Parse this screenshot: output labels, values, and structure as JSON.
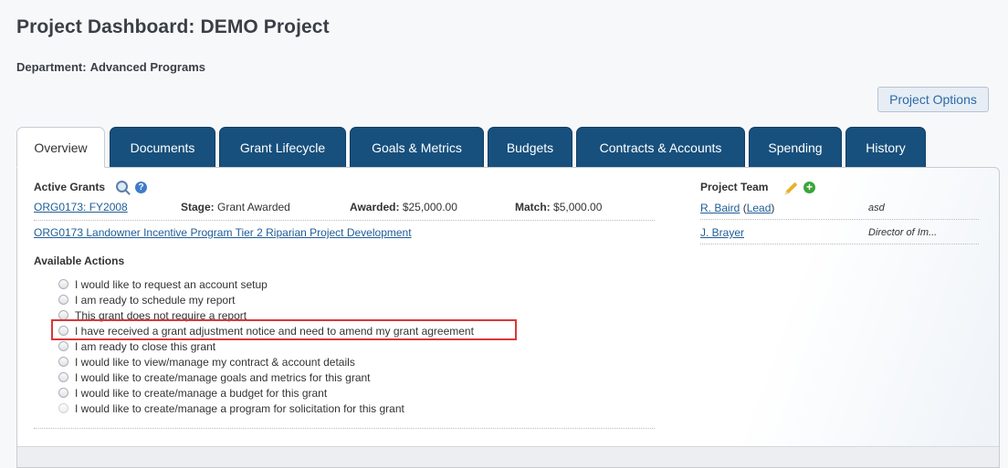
{
  "header": {
    "title": "Project Dashboard: DEMO Project",
    "department_label": "Department:",
    "department_value": "Advanced Programs",
    "options_button": "Project Options"
  },
  "tabs": [
    {
      "label": "Overview",
      "active": true
    },
    {
      "label": "Documents",
      "active": false
    },
    {
      "label": "Grant Lifecycle",
      "active": false
    },
    {
      "label": "Goals & Metrics",
      "active": false
    },
    {
      "label": "Budgets",
      "active": false
    },
    {
      "label": "Contracts & Accounts",
      "active": false
    },
    {
      "label": "Spending",
      "active": false
    },
    {
      "label": "History",
      "active": false
    }
  ],
  "icons": {
    "search": "magnifier",
    "help": "?",
    "edit": "pencil",
    "add": "+"
  },
  "active_grants": {
    "heading": "Active Grants",
    "grant_id": "ORG0173: FY2008",
    "stage_label": "Stage:",
    "stage_value": "Grant Awarded",
    "awarded_label": "Awarded:",
    "awarded_value": "$25,000.00",
    "match_label": "Match:",
    "match_value": "$5,000.00",
    "grant_title": "ORG0173 Landowner Incentive Program Tier 2 Riparian Project Development"
  },
  "project_team": {
    "heading": "Project Team",
    "members": [
      {
        "name": "R. Baird",
        "role_link": "Lead",
        "note": "asd"
      },
      {
        "name": "J. Brayer",
        "role_link": "",
        "note": "Director of Im..."
      }
    ]
  },
  "available_actions": {
    "heading": "Available Actions",
    "options": [
      {
        "label": "I would like to request an account setup",
        "disabled": false
      },
      {
        "label": "I am ready to schedule my report",
        "disabled": false
      },
      {
        "label": "This grant does not require a report",
        "disabled": false
      },
      {
        "label": "I have received a grant adjustment notice and need to amend my grant agreement",
        "disabled": false,
        "highlighted": true
      },
      {
        "label": "I am ready to close this grant",
        "disabled": false
      },
      {
        "label": "I would like to view/manage my contract & account details",
        "disabled": false
      },
      {
        "label": "I would like to create/manage goals and metrics for this grant",
        "disabled": false
      },
      {
        "label": "I would like to create/manage a budget for this grant",
        "disabled": false
      },
      {
        "label": "I would like to create/manage a program for solicitation for this grant",
        "disabled": true
      }
    ]
  },
  "colors": {
    "tab_dark": "#17507d",
    "link": "#1f5d96",
    "highlight_border": "#d9383a"
  }
}
